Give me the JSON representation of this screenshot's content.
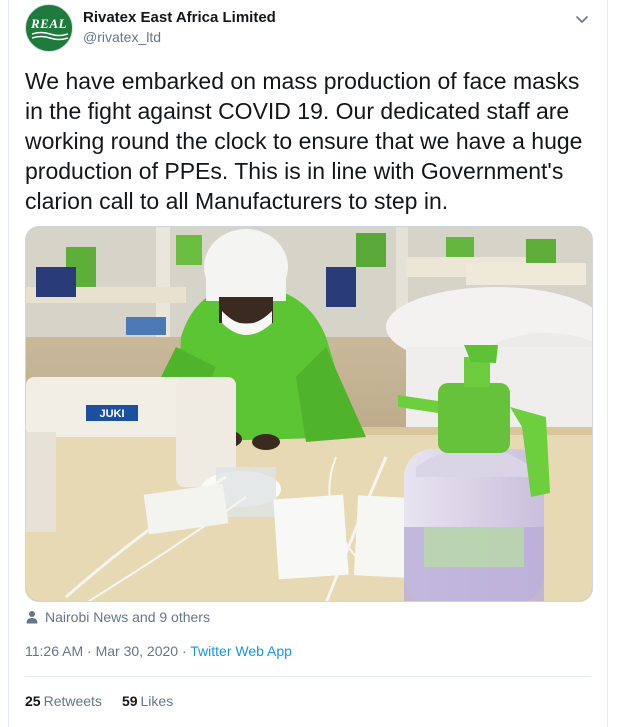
{
  "account": {
    "display_name": "Rivatex East Africa Limited",
    "handle": "@rivatex_ltd",
    "avatar_logo_text": "REAL"
  },
  "tweet": {
    "text": "We have embarked on mass production of face masks in the fight against COVID 19. Our dedicated staff are working round the clock to ensure that we have a huge production of PPEs. This is in line with Government's clarion call to all Manufacturers to step in."
  },
  "media": {
    "machine_brand": "JUKI",
    "description_icon": "photo"
  },
  "tagged": {
    "text": "Nairobi News and 9 others",
    "icon": "person-icon"
  },
  "meta": {
    "time": "11:26 AM",
    "separator": "·",
    "date": "Mar 30, 2020",
    "app": "Twitter Web App"
  },
  "stats": {
    "retweets_count": "25",
    "retweets_label": "Retweets",
    "likes_count": "59",
    "likes_label": "Likes"
  },
  "colors": {
    "link": "#1b95e0",
    "muted": "#657786",
    "text": "#14171a",
    "brand_green": "#1f7a3d"
  }
}
